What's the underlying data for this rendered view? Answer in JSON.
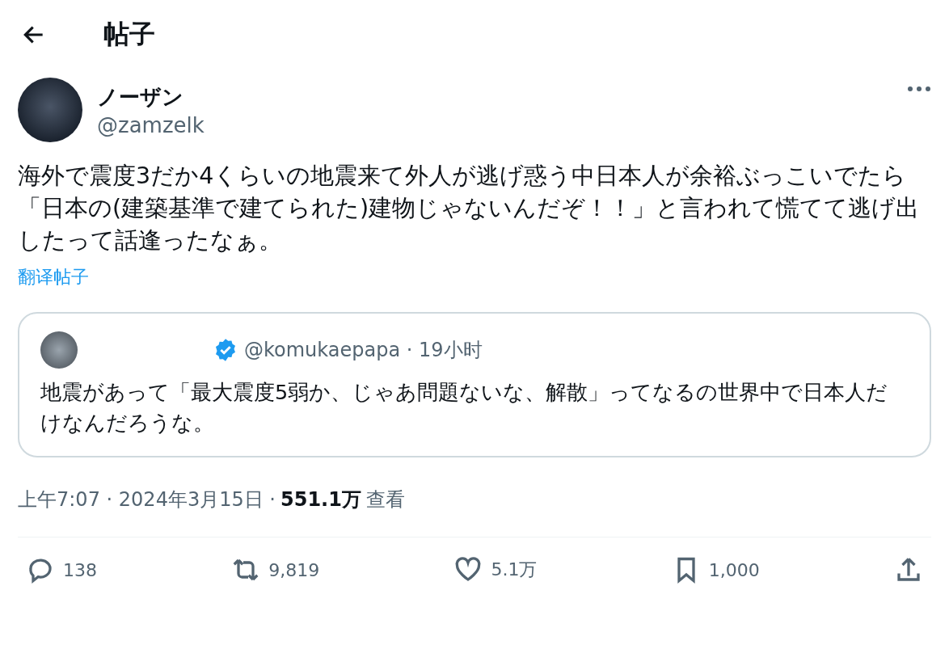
{
  "header": {
    "title": "帖子"
  },
  "post": {
    "name": "ノーザン",
    "handle": "@zamzelk",
    "text": "海外で震度3だか4くらいの地震来て外人が逃げ惑う中日本人が余裕ぶっこいでたら「日本の(建築基準で建てられた)建物じゃないんだぞ！！」と言われて慌てて逃げ出したって話逢ったなぁ。",
    "translate": "翻译帖子"
  },
  "quote": {
    "verified": true,
    "handle": "@komukaepapa",
    "separator": "·",
    "time": "19小时",
    "text": "地震があって「最大震度5弱か、じゃあ問題ないな、解散」ってなるの世界中で日本人だけなんだろうな。"
  },
  "meta": {
    "time": "上午7:07",
    "separator": "·",
    "date": "2024年3月15日",
    "views": "551.1万",
    "views_label": "查看"
  },
  "actions": [
    {
      "kind": "reply",
      "count": "138"
    },
    {
      "kind": "repost",
      "count": "9,819"
    },
    {
      "kind": "like",
      "count": "5.1万"
    },
    {
      "kind": "bookmark",
      "count": "1,000"
    },
    {
      "kind": "share"
    }
  ]
}
